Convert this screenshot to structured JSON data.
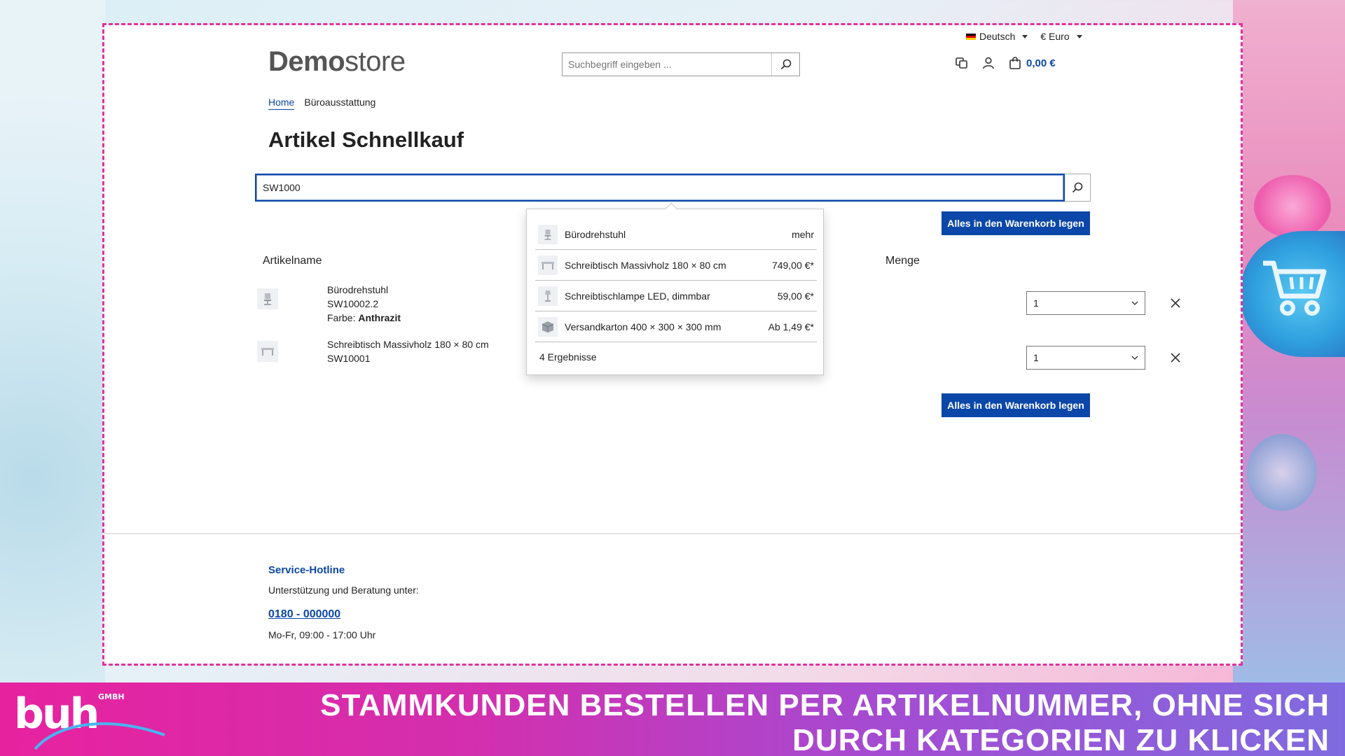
{
  "header": {
    "language": "Deutsch",
    "currency": "€ Euro",
    "logo_bold": "Demo",
    "logo_light": "store",
    "search_placeholder": "Suchbegriff eingeben ...",
    "cart_total": "0,00 €"
  },
  "breadcrumb": {
    "home": "Home",
    "current": "Büroausstattung"
  },
  "page": {
    "title": "Artikel Schnellkauf",
    "sku_search_value": "SW1000",
    "add_all_label": "Alles in den Warenkorb legen",
    "column_name": "Artikelname",
    "column_qty": "Menge"
  },
  "rows": [
    {
      "name": "Bürodrehstuhl",
      "sku": "SW10002.2",
      "color_label": "Farbe:",
      "color_value": "Anthrazit",
      "qty": "1"
    },
    {
      "name": "Schreibtisch Massivholz 180 × 80 cm",
      "sku": "SW10001",
      "qty": "1"
    }
  ],
  "dropdown": {
    "items": [
      {
        "name": "Bürodrehstuhl",
        "price": "mehr",
        "icon": "chair-icon"
      },
      {
        "name": "Schreibtisch Massivholz 180 × 80 cm",
        "price": "749,00 €*",
        "icon": "desk-icon"
      },
      {
        "name": "Schreibtischlampe LED, dimmbar",
        "price": "59,00 €*",
        "icon": "lamp-icon"
      },
      {
        "name": "Versandkarton 400 × 300 × 300 mm",
        "price": "Ab 1,49 €*",
        "icon": "box-icon"
      }
    ],
    "count": "4 Ergebnisse"
  },
  "footer": {
    "hotline_title": "Service-Hotline",
    "hotline_sub": "Unterstützung und Beratung unter:",
    "phone": "0180 - 000000",
    "hours": "Mo-Fr, 09:00 - 17:00 Uhr"
  },
  "banner": {
    "logo": "buh",
    "logo_suffix": "GMBH",
    "line1": "STAMMKUNDEN BESTELLEN PER ARTIKELNUMMER, OHNE SICH",
    "line2": "DURCH KATEGORIEN ZU KLICKEN"
  },
  "colors": {
    "primary": "#0b47a8",
    "frame_border": "#e0329e",
    "banner_start": "#e7229f",
    "banner_end": "#7f6be0"
  }
}
